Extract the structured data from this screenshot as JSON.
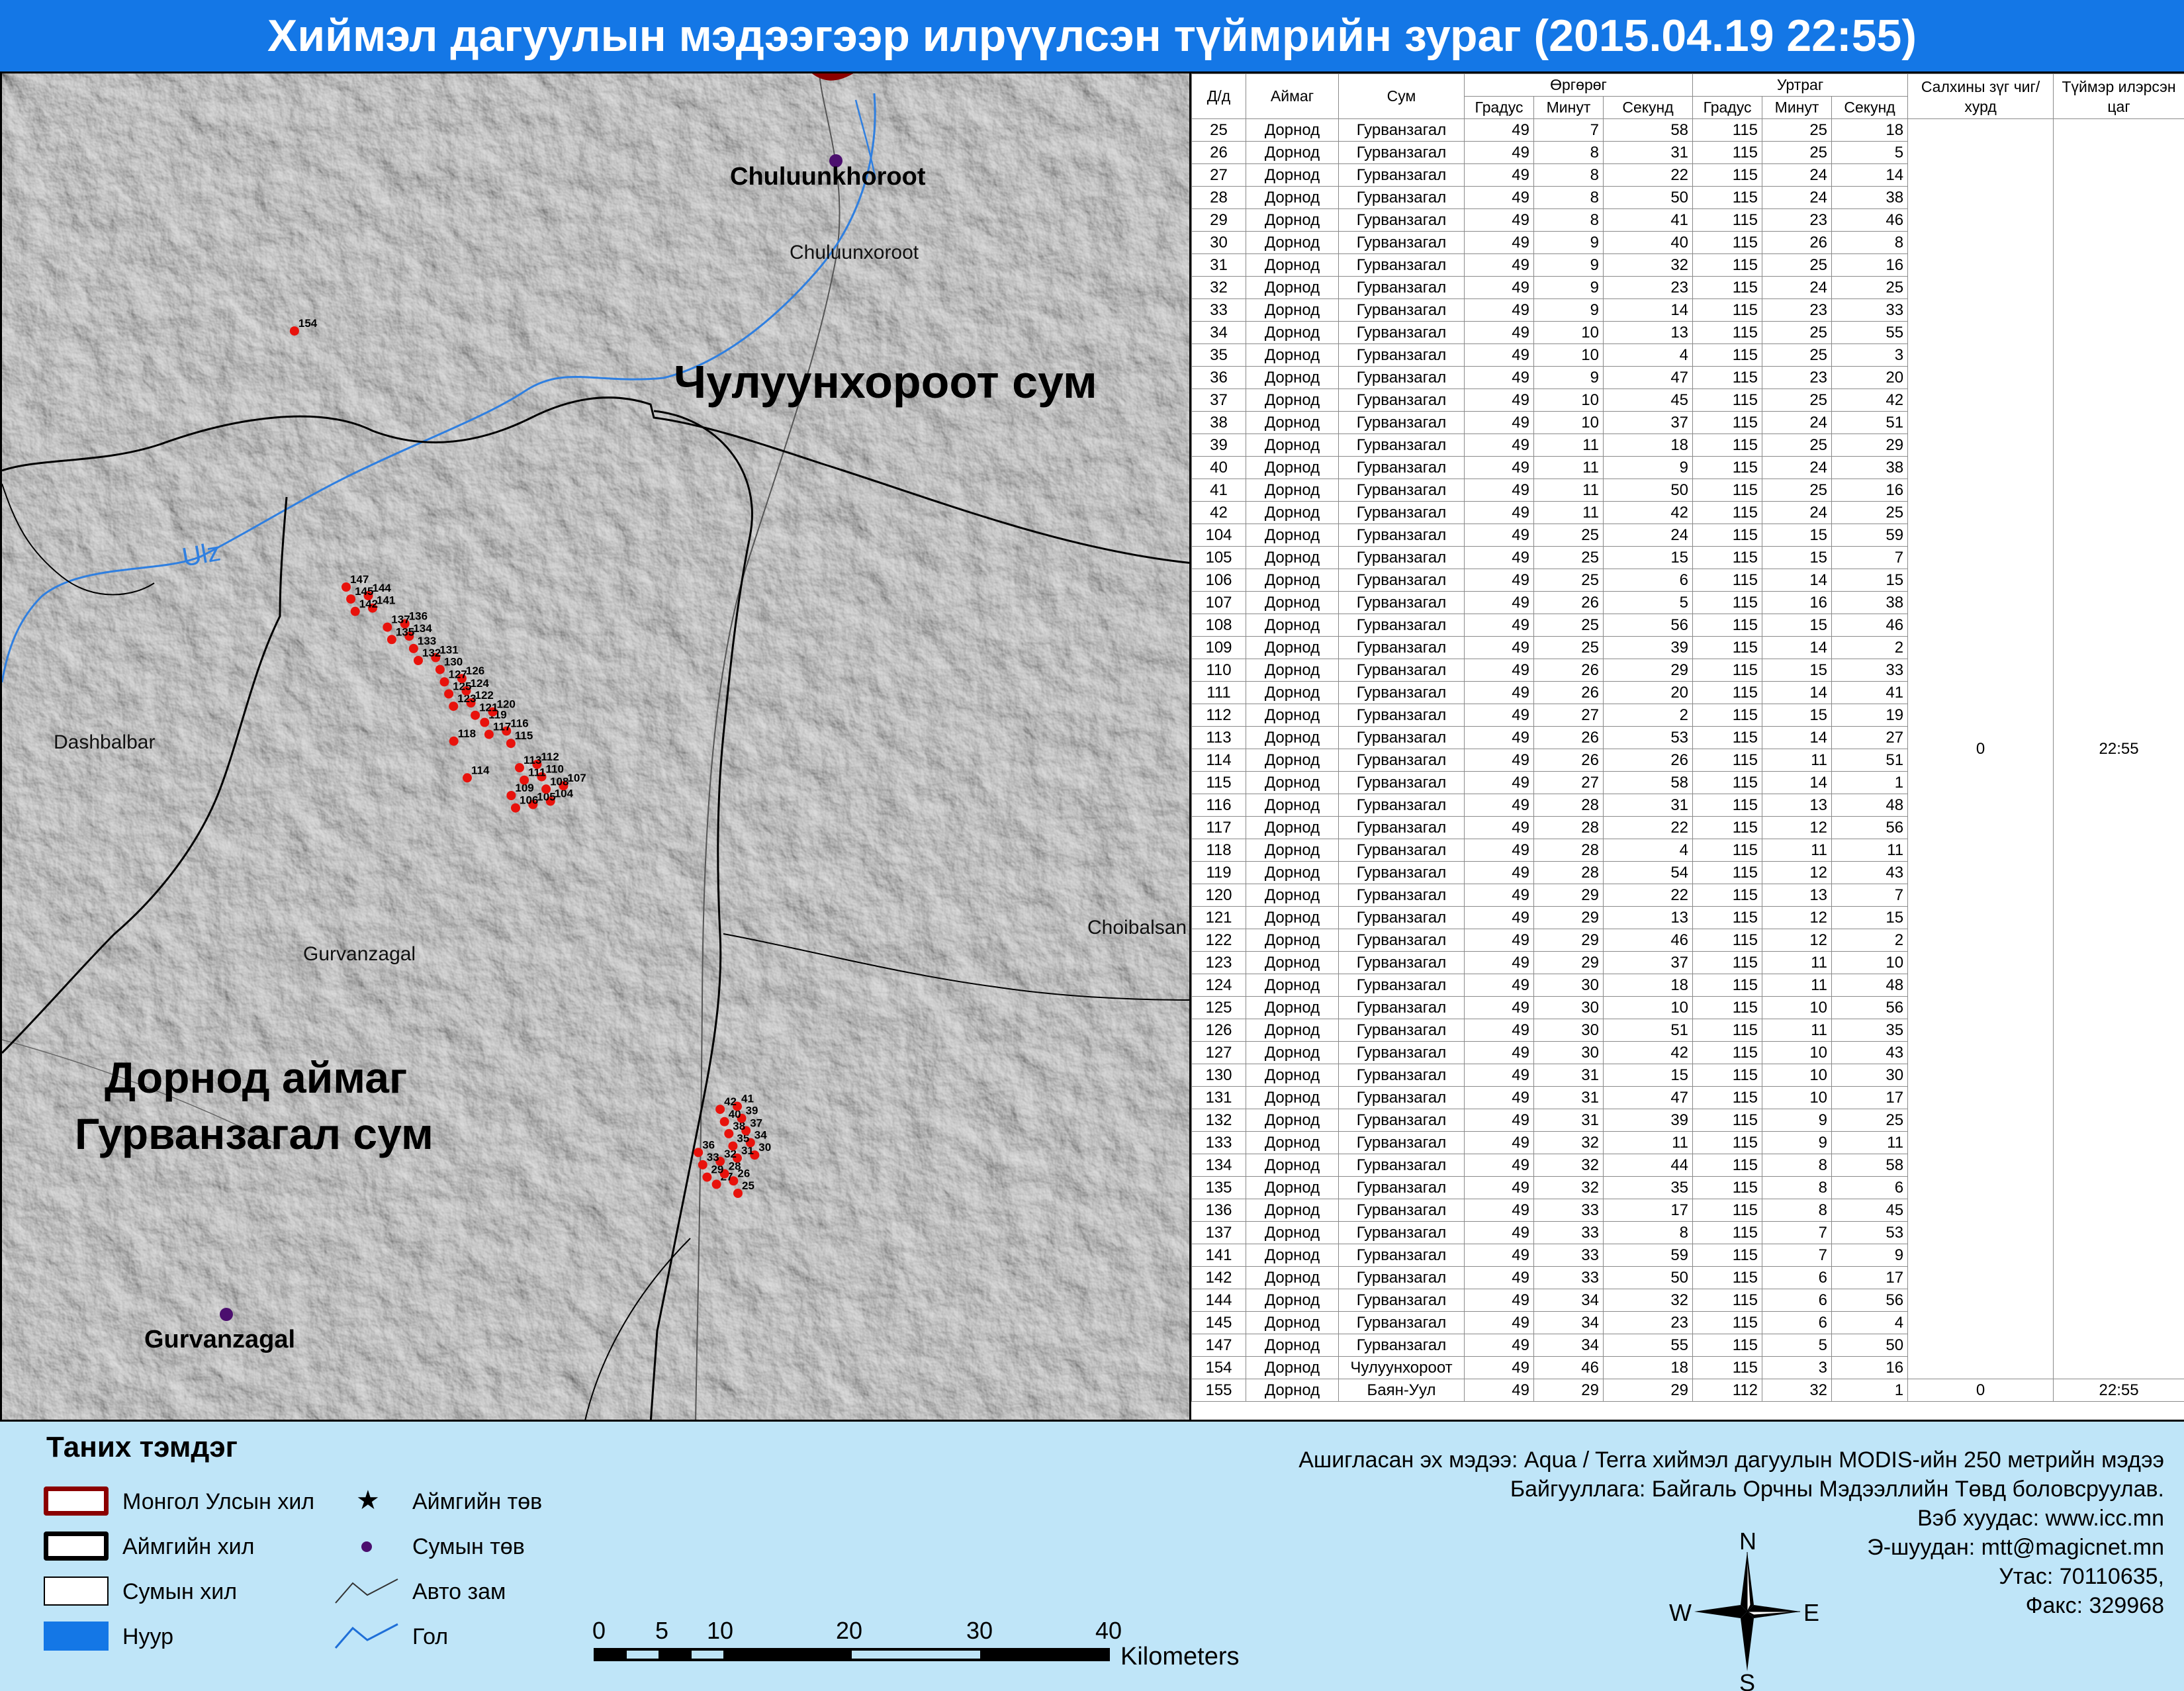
{
  "title": "Хиймэл дагуулын мэдээгээр илрүүлсэн түймрийн зураг  (2015.04.19 22:55)",
  "map": {
    "place_labels": {
      "chuluunkhoroot_center": "Chuluunkhoroot",
      "chuluunxoroot": "Chuluunxoroot",
      "chuluunkhoroot_sum": "Чулуунхороот сум",
      "ulz_river": "Ulz",
      "dashbalbar": "Dashbalbar",
      "gurvanzagal_area": "Gurvanzagal",
      "choibalsan": "Choibalsan",
      "dornod_aimag": "Дорнод аймаг",
      "gurvanzagal_sum": "Гурванзагал сум",
      "gurvanzagal_center": "Gurvanzagal"
    },
    "colors": {
      "fire_point": "#e8120c",
      "sum_center": "#4b0f6e",
      "river": "#2f7fe0",
      "border": "#000000",
      "country_border": "#8b0000"
    },
    "scale": {
      "labels": [
        "0",
        "5",
        "10",
        "20",
        "30",
        "40"
      ],
      "unit": "Kilometers"
    },
    "north_arrow": {
      "n": "N",
      "s": "S",
      "e": "E",
      "w": "W"
    }
  },
  "table": {
    "headers": {
      "dd": "Д/д",
      "aimag": "Аймаг",
      "sum": "Сум",
      "lat": "Өргөрөг",
      "lon": "Уртраг",
      "deg": "Градус",
      "min": "Минут",
      "sec": "Секунд",
      "wind": "Салхины зүг чиг/хурд",
      "time": "Түймэр илэрсэн цаг"
    },
    "merged_wind": "0",
    "merged_time": "22:55",
    "last_wind": "0",
    "last_time": "22:55",
    "rows": [
      [
        "25",
        "Дорнод",
        "Гурванзагал",
        "49",
        "7",
        "58",
        "115",
        "25",
        "18"
      ],
      [
        "26",
        "Дорнод",
        "Гурванзагал",
        "49",
        "8",
        "31",
        "115",
        "25",
        "5"
      ],
      [
        "27",
        "Дорнод",
        "Гурванзагал",
        "49",
        "8",
        "22",
        "115",
        "24",
        "14"
      ],
      [
        "28",
        "Дорнод",
        "Гурванзагал",
        "49",
        "8",
        "50",
        "115",
        "24",
        "38"
      ],
      [
        "29",
        "Дорнод",
        "Гурванзагал",
        "49",
        "8",
        "41",
        "115",
        "23",
        "46"
      ],
      [
        "30",
        "Дорнод",
        "Гурванзагал",
        "49",
        "9",
        "40",
        "115",
        "26",
        "8"
      ],
      [
        "31",
        "Дорнод",
        "Гурванзагал",
        "49",
        "9",
        "32",
        "115",
        "25",
        "16"
      ],
      [
        "32",
        "Дорнод",
        "Гурванзагал",
        "49",
        "9",
        "23",
        "115",
        "24",
        "25"
      ],
      [
        "33",
        "Дорнод",
        "Гурванзагал",
        "49",
        "9",
        "14",
        "115",
        "23",
        "33"
      ],
      [
        "34",
        "Дорнод",
        "Гурванзагал",
        "49",
        "10",
        "13",
        "115",
        "25",
        "55"
      ],
      [
        "35",
        "Дорнод",
        "Гурванзагал",
        "49",
        "10",
        "4",
        "115",
        "25",
        "3"
      ],
      [
        "36",
        "Дорнод",
        "Гурванзагал",
        "49",
        "9",
        "47",
        "115",
        "23",
        "20"
      ],
      [
        "37",
        "Дорнод",
        "Гурванзагал",
        "49",
        "10",
        "45",
        "115",
        "25",
        "42"
      ],
      [
        "38",
        "Дорнод",
        "Гурванзагал",
        "49",
        "10",
        "37",
        "115",
        "24",
        "51"
      ],
      [
        "39",
        "Дорнод",
        "Гурванзагал",
        "49",
        "11",
        "18",
        "115",
        "25",
        "29"
      ],
      [
        "40",
        "Дорнод",
        "Гурванзагал",
        "49",
        "11",
        "9",
        "115",
        "24",
        "38"
      ],
      [
        "41",
        "Дорнод",
        "Гурванзагал",
        "49",
        "11",
        "50",
        "115",
        "25",
        "16"
      ],
      [
        "42",
        "Дорнод",
        "Гурванзагал",
        "49",
        "11",
        "42",
        "115",
        "24",
        "25"
      ],
      [
        "104",
        "Дорнод",
        "Гурванзагал",
        "49",
        "25",
        "24",
        "115",
        "15",
        "59"
      ],
      [
        "105",
        "Дорнод",
        "Гурванзагал",
        "49",
        "25",
        "15",
        "115",
        "15",
        "7"
      ],
      [
        "106",
        "Дорнод",
        "Гурванзагал",
        "49",
        "25",
        "6",
        "115",
        "14",
        "15"
      ],
      [
        "107",
        "Дорнод",
        "Гурванзагал",
        "49",
        "26",
        "5",
        "115",
        "16",
        "38"
      ],
      [
        "108",
        "Дорнод",
        "Гурванзагал",
        "49",
        "25",
        "56",
        "115",
        "15",
        "46"
      ],
      [
        "109",
        "Дорнод",
        "Гурванзагал",
        "49",
        "25",
        "39",
        "115",
        "14",
        "2"
      ],
      [
        "110",
        "Дорнод",
        "Гурванзагал",
        "49",
        "26",
        "29",
        "115",
        "15",
        "33"
      ],
      [
        "111",
        "Дорнод",
        "Гурванзагал",
        "49",
        "26",
        "20",
        "115",
        "14",
        "41"
      ],
      [
        "112",
        "Дорнод",
        "Гурванзагал",
        "49",
        "27",
        "2",
        "115",
        "15",
        "19"
      ],
      [
        "113",
        "Дорнод",
        "Гурванзагал",
        "49",
        "26",
        "53",
        "115",
        "14",
        "27"
      ],
      [
        "114",
        "Дорнод",
        "Гурванзагал",
        "49",
        "26",
        "26",
        "115",
        "11",
        "51"
      ],
      [
        "115",
        "Дорнод",
        "Гурванзагал",
        "49",
        "27",
        "58",
        "115",
        "14",
        "1"
      ],
      [
        "116",
        "Дорнод",
        "Гурванзагал",
        "49",
        "28",
        "31",
        "115",
        "13",
        "48"
      ],
      [
        "117",
        "Дорнод",
        "Гурванзагал",
        "49",
        "28",
        "22",
        "115",
        "12",
        "56"
      ],
      [
        "118",
        "Дорнод",
        "Гурванзагал",
        "49",
        "28",
        "4",
        "115",
        "11",
        "11"
      ],
      [
        "119",
        "Дорнод",
        "Гурванзагал",
        "49",
        "28",
        "54",
        "115",
        "12",
        "43"
      ],
      [
        "120",
        "Дорнод",
        "Гурванзагал",
        "49",
        "29",
        "22",
        "115",
        "13",
        "7"
      ],
      [
        "121",
        "Дорнод",
        "Гурванзагал",
        "49",
        "29",
        "13",
        "115",
        "12",
        "15"
      ],
      [
        "122",
        "Дорнод",
        "Гурванзагал",
        "49",
        "29",
        "46",
        "115",
        "12",
        "2"
      ],
      [
        "123",
        "Дорнод",
        "Гурванзагал",
        "49",
        "29",
        "37",
        "115",
        "11",
        "10"
      ],
      [
        "124",
        "Дорнод",
        "Гурванзагал",
        "49",
        "30",
        "18",
        "115",
        "11",
        "48"
      ],
      [
        "125",
        "Дорнод",
        "Гурванзагал",
        "49",
        "30",
        "10",
        "115",
        "10",
        "56"
      ],
      [
        "126",
        "Дорнод",
        "Гурванзагал",
        "49",
        "30",
        "51",
        "115",
        "11",
        "35"
      ],
      [
        "127",
        "Дорнод",
        "Гурванзагал",
        "49",
        "30",
        "42",
        "115",
        "10",
        "43"
      ],
      [
        "130",
        "Дорнод",
        "Гурванзагал",
        "49",
        "31",
        "15",
        "115",
        "10",
        "30"
      ],
      [
        "131",
        "Дорнод",
        "Гурванзагал",
        "49",
        "31",
        "47",
        "115",
        "10",
        "17"
      ],
      [
        "132",
        "Дорнод",
        "Гурванзагал",
        "49",
        "31",
        "39",
        "115",
        "9",
        "25"
      ],
      [
        "133",
        "Дорнод",
        "Гурванзагал",
        "49",
        "32",
        "11",
        "115",
        "9",
        "11"
      ],
      [
        "134",
        "Дорнод",
        "Гурванзагал",
        "49",
        "32",
        "44",
        "115",
        "8",
        "58"
      ],
      [
        "135",
        "Дорнод",
        "Гурванзагал",
        "49",
        "32",
        "35",
        "115",
        "8",
        "6"
      ],
      [
        "136",
        "Дорнод",
        "Гурванзагал",
        "49",
        "33",
        "17",
        "115",
        "8",
        "45"
      ],
      [
        "137",
        "Дорнод",
        "Гурванзагал",
        "49",
        "33",
        "8",
        "115",
        "7",
        "53"
      ],
      [
        "141",
        "Дорнод",
        "Гурванзагал",
        "49",
        "33",
        "59",
        "115",
        "7",
        "9"
      ],
      [
        "142",
        "Дорнод",
        "Гурванзагал",
        "49",
        "33",
        "50",
        "115",
        "6",
        "17"
      ],
      [
        "144",
        "Дорнод",
        "Гурванзагал",
        "49",
        "34",
        "32",
        "115",
        "6",
        "56"
      ],
      [
        "145",
        "Дорнод",
        "Гурванзагал",
        "49",
        "34",
        "23",
        "115",
        "6",
        "4"
      ],
      [
        "147",
        "Дорнод",
        "Гурванзагал",
        "49",
        "34",
        "55",
        "115",
        "5",
        "50"
      ],
      [
        "154",
        "Дорнод",
        "Чулуунхороот",
        "49",
        "46",
        "18",
        "115",
        "3",
        "16"
      ]
    ],
    "last_row": [
      "155",
      "Дорнод",
      "Баян-Уул",
      "49",
      "29",
      "29",
      "112",
      "32",
      "1"
    ]
  },
  "legend": {
    "title": "Таних тэмдэг",
    "items": {
      "country": "Монгол Улсын хил",
      "aimag": "Аймгийн хил",
      "sum": "Сумын хил",
      "lake": "Нуур",
      "aimag_center": "Аймгийн төв",
      "sum_center": "Сумын төв",
      "road": "Авто зам",
      "river": "Гол"
    }
  },
  "credits": {
    "source": "Ашигласан эх мэдээ: Aqua / Terra хиймэл дагуулын MODIS-ийн 250 метрийн мэдээ",
    "org": "Байгууллага: Байгаль Орчны Мэдээллийн Төвд боловсруулав.",
    "web": "Вэб хуудас: www.icc.mn",
    "email": "Э-шуудан: mtt@magicnet.mn",
    "phone": "Утас: 70110635,",
    "fax": "Факс: 329968"
  }
}
